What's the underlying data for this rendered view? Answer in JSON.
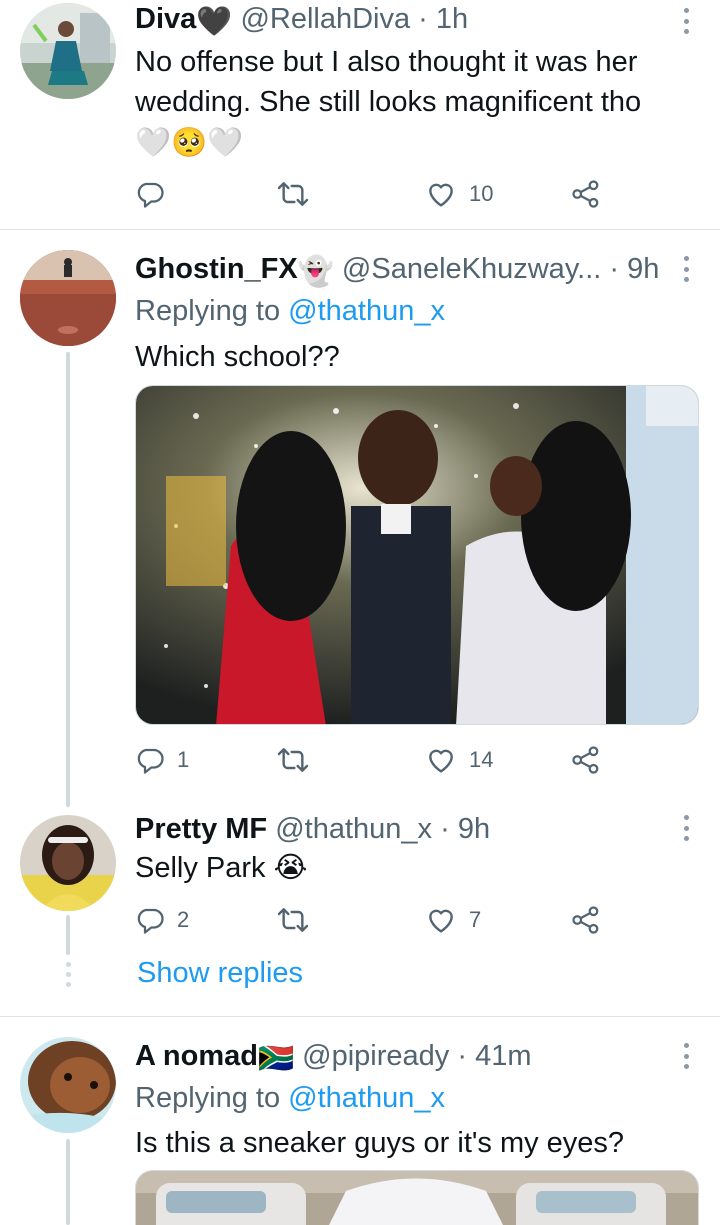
{
  "tweets": [
    {
      "name": "Diva",
      "name_emoji": "🖤",
      "handle": "@RellahDiva",
      "dot": "·",
      "time": "1h",
      "lines": [
        "No offense but I also thought it was her",
        "wedding. She still looks magnificent tho",
        "🤍🥺🤍"
      ],
      "reply_count": "",
      "like_count": "10"
    },
    {
      "name": "Ghostin_FX",
      "name_emoji": "👻",
      "handle": "@SaneleKhuzway...",
      "dot": "·",
      "time": "9h",
      "replying_prefix": "Replying to",
      "replying_to": "@thathun_x",
      "lines": [
        "Which school??"
      ],
      "reply_count": "1",
      "like_count": "14"
    },
    {
      "name": "Pretty MF",
      "handle": "@thathun_x",
      "dot": "·",
      "time": "9h",
      "lines": [
        "Selly Park 😭"
      ],
      "reply_count": "2",
      "like_count": "7",
      "show_replies": "Show replies"
    },
    {
      "name": "A nomad",
      "name_emoji": "🇿🇦",
      "handle": "@pipiready",
      "dot": "·",
      "time": "41m",
      "replying_prefix": "Replying to",
      "replying_to": "@thathun_x",
      "lines": [
        "Is this a sneaker guys or it's my eyes?"
      ]
    }
  ],
  "icons": {
    "reply": "reply-icon",
    "retweet": "retweet-icon",
    "like": "heart-icon",
    "share": "share-icon",
    "more": "more-icon"
  },
  "colors": {
    "text": "#0f1419",
    "secondary": "#536471",
    "link": "#1d9bf0",
    "divider": "#dfe3e7",
    "thread_line": "#cfd9de"
  }
}
